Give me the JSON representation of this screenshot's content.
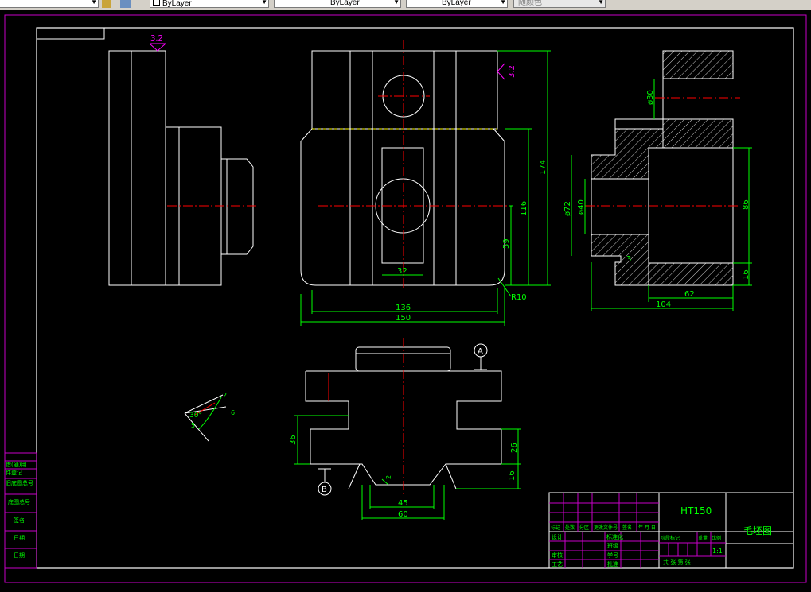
{
  "toolbar": {
    "layer_left": "ByLayer",
    "linetype": "ByLayer",
    "lineweight": "ByLayer",
    "plotstyle": "随颜色"
  },
  "dims": {
    "roughness_left": "3.2",
    "roughness_right": "3.2",
    "d174": "174",
    "d116": "116",
    "d59": "59",
    "d32": "32",
    "d136": "136",
    "d150": "150",
    "r10": "R10",
    "d30": "ø30",
    "d72": "ø72",
    "d40": "ø40",
    "d86": "86",
    "d16r": "16",
    "d3": "3",
    "d62": "62",
    "d104": "104",
    "d36": "36",
    "d26": "26",
    "d16b": "16",
    "d45": "45",
    "d60": "60",
    "d2": "2",
    "datumA": "A",
    "datumB": "B",
    "ang30": "30°",
    "ang2": "2",
    "ang5": "5",
    "ang6": "6"
  },
  "sidebar": {
    "rows": [
      "借(通)用",
      "件登记",
      "旧底图总号",
      "底图总号",
      "签名",
      "日期",
      "日期"
    ]
  },
  "title_block": {
    "material": "HT150",
    "drawing_name": "毛坯图",
    "scale": "1:1",
    "headers": [
      "标记",
      "处数",
      "分区",
      "更改文件号",
      "签名",
      "年 月 日"
    ],
    "design": "设计",
    "standardize": "标准化",
    "check": "审核",
    "process": "工艺",
    "stage_mark": "阶段标记",
    "weight": "重量",
    "ratio": "比例",
    "sheets": "共  张  第  张",
    "approve": "批准",
    "class": "班级",
    "student_no": "学号"
  }
}
